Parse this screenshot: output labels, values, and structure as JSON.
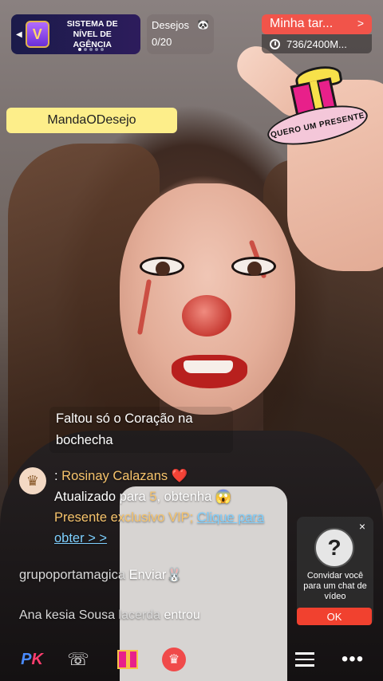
{
  "agency_banner": {
    "label": "SISTEMA DE NÍVEL DE AGÊNCIA",
    "badge": "V",
    "arrow_icon": "chevron-left-icon"
  },
  "wishes": {
    "title": "Desejos",
    "count": "0/20",
    "icon": "panda-icon"
  },
  "task": {
    "label": "Minha tar...",
    "progress": "736/2400M...",
    "icon": "clock-icon"
  },
  "sticker": {
    "text": "QUERO UM PRESENTE"
  },
  "tag": {
    "label": "MandaODesejo"
  },
  "chat": {
    "msg1": "Faltou só o Coração na bochecha",
    "msg2": {
      "prefix": ": ",
      "name": "Rosinay Calazans",
      "heart": "❤️",
      "text1": "Atualizado para ",
      "level": "5",
      "text2": ", obtenha ",
      "emoji": "😱",
      "vip": "Presente exclusivo VIP; ",
      "link": "Clique para obter > >"
    },
    "msg3": {
      "user": "grupoportamagica",
      "action": "Enviar",
      "emoji": "🐰"
    },
    "msg4": {
      "user": "Ana kesia Sousa lacerda",
      "action": "entrou"
    }
  },
  "invite": {
    "text": "Convidar você para um chat de vídeo",
    "ok": "OK",
    "close": "×",
    "avatar": "?"
  },
  "bottom_bar": {
    "pk_p": "P",
    "pk_k": "K",
    "call_icon": "☏",
    "rose_icon": "♛",
    "more": "•••"
  },
  "colors": {
    "task_red": "#f1544a",
    "tag_yellow": "#fdee8a",
    "ok_red": "#f1412f",
    "name_gold": "#f7c46c",
    "link_blue": "#7fd0ff"
  }
}
